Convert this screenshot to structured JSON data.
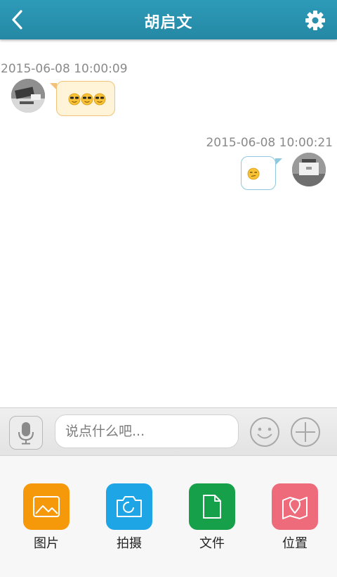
{
  "header": {
    "title": "胡启文",
    "color": "#2890ad",
    "back_icon": "chevron-left-icon",
    "settings_icon": "gear-icon"
  },
  "messages": [
    {
      "timestamp": "2015-06-08 10:00:09",
      "side": "left",
      "content": "emoji x3 (cool sunglasses)"
    },
    {
      "timestamp": "2015-06-08 10:00:21",
      "side": "right",
      "content": "emoji x1 (smirk)"
    }
  ],
  "input_bar": {
    "placeholder": "说点什么吧...",
    "voice_icon": "microphone-icon",
    "emoji_icon": "smiley-icon",
    "plus_icon": "plus-icon"
  },
  "actions": [
    {
      "label": "图片",
      "color": "#f5980a",
      "icon": "image-icon"
    },
    {
      "label": "拍摄",
      "color": "#1ea5e6",
      "icon": "camera-icon"
    },
    {
      "label": "文件",
      "color": "#16a04a",
      "icon": "file-icon"
    },
    {
      "label": "位置",
      "color": "#ee6b7c",
      "icon": "map-icon"
    }
  ]
}
